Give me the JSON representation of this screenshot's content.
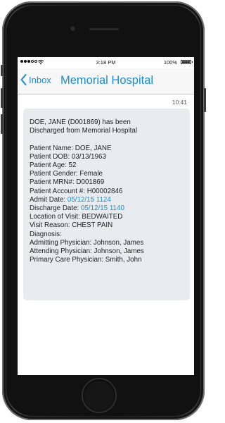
{
  "status_bar": {
    "time": "3:18 PM",
    "battery": "100%",
    "signal_bars": 3,
    "icons": [
      "signal-icon",
      "wifi-icon",
      "battery-icon"
    ]
  },
  "nav": {
    "back_label": "Inbox",
    "title": "Memorial Hospital"
  },
  "message": {
    "timestamp": "10:41",
    "heading_line1": "DOE, JANE (D001869) has been",
    "heading_line2": "Discharged from Memorial Hospital",
    "fields": {
      "patient_name": "Patient Name: DOE, JANE",
      "patient_dob": "Patient DOB: 03/13/1963",
      "patient_age": "Patient Age: 52",
      "patient_gender": "Patient Gender: Female",
      "patient_mrn": "Patient MRN#: D001869",
      "patient_account": "Patient Account #: H00002846",
      "admit_date_label": "Admit Date: ",
      "admit_date_value": "05/12/15 1124",
      "discharge_date_label": "Discharge Date: ",
      "discharge_date_value": "05/12/15 1140",
      "location": "Location of Visit: BEDWAITED",
      "visit_reason": "Visit Reason: CHEST PAIN",
      "diagnosis": "Diagnosis:",
      "admitting_physician": "Admitting Physician: Johnson, James",
      "attending_physician": "Attending Physician: Johnson, James",
      "primary_care_physician": "Primary Care Physician: Smith, John"
    }
  },
  "colors": {
    "accent": "#1a8ed6",
    "bubble": "#e9ecef",
    "phone_body": "#1f1f1f"
  }
}
